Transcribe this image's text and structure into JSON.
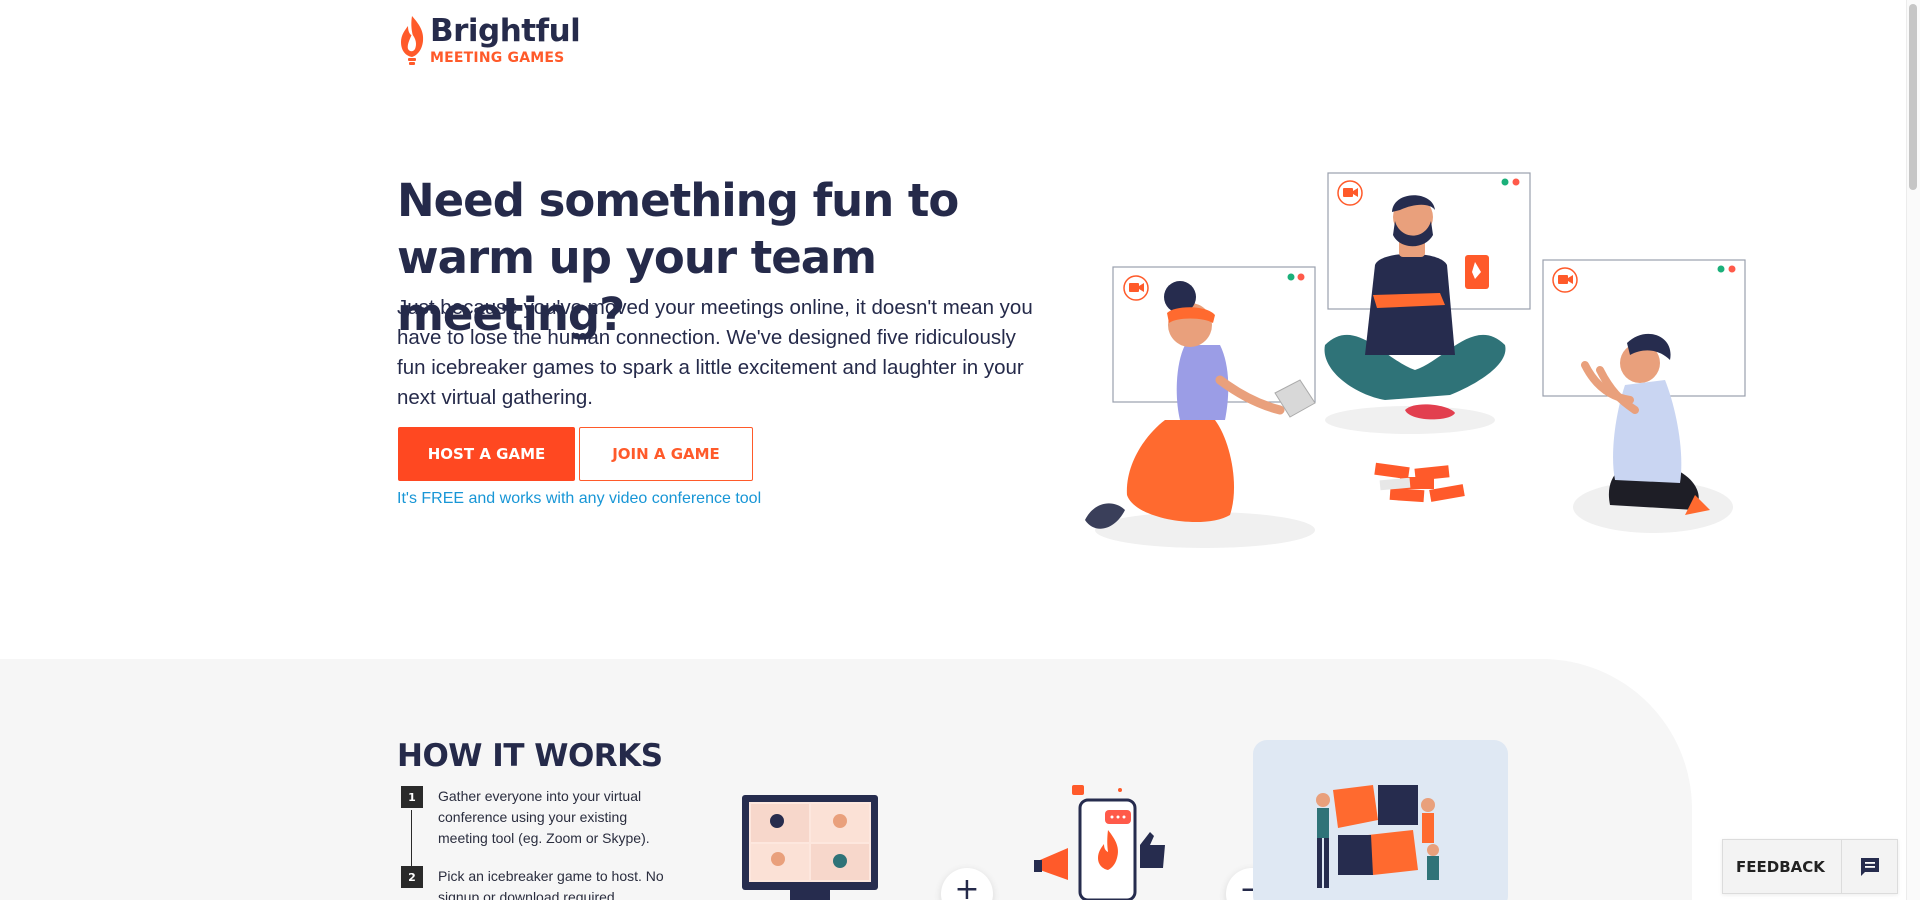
{
  "brand": {
    "name": "Brightful",
    "subtitle": "MEETING GAMES",
    "accent_color": "#ff5a2a",
    "navy_color": "#252a4a",
    "link_color": "#1896d6"
  },
  "hero": {
    "title": "Need something fun to warm up your team meeting?",
    "body": "Just because you've moved your meetings online, it doesn't mean you have to lose the human connection. We've designed five ridiculously fun icebreaker games to spark a little excitement and laughter in your next virtual gathering.",
    "host_button": "HOST A GAME",
    "join_button": "JOIN A GAME",
    "free_note": "It's FREE and works with any video conference tool"
  },
  "how_it_works": {
    "title": "HOW IT WORKS",
    "steps": [
      {
        "num": "1",
        "text": "Gather everyone into your virtual conference using your existing meeting tool (eg. Zoom or Skype)."
      },
      {
        "num": "2",
        "text": "Pick an icebreaker game to host. No signup or download required."
      }
    ],
    "plus_symbol": "+",
    "minus_symbol": "−"
  },
  "feedback": {
    "label": "FEEDBACK",
    "icon": "chat-bubble-icon"
  },
  "icons": {
    "logo": "flame-logo-icon",
    "video_camera": "video-camera-icon"
  }
}
